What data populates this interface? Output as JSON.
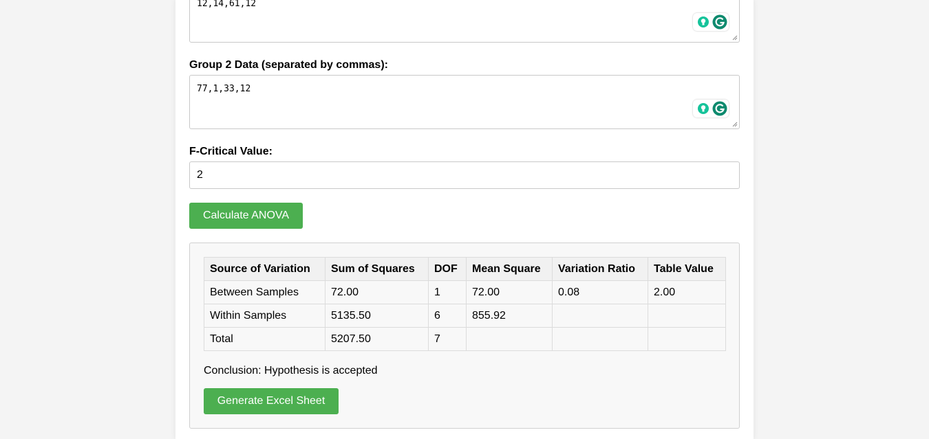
{
  "group1": {
    "value": "12,14,61,12"
  },
  "group2": {
    "label": "Group 2 Data (separated by commas):",
    "value": "77,1,33,12"
  },
  "f_critical": {
    "label": "F-Critical Value:",
    "value": "2"
  },
  "buttons": {
    "calculate": "Calculate ANOVA",
    "excel": "Generate Excel Sheet"
  },
  "table": {
    "headers": [
      "Source of Variation",
      "Sum of Squares",
      "DOF",
      "Mean Square",
      "Variation Ratio",
      "Table Value"
    ],
    "rows": [
      [
        "Between Samples",
        "72.00",
        "1",
        "72.00",
        "0.08",
        "2.00"
      ],
      [
        "Within Samples",
        "5135.50",
        "6",
        "855.92",
        "",
        ""
      ],
      [
        "Total",
        "5207.50",
        "7",
        "",
        "",
        ""
      ]
    ]
  },
  "conclusion": "Conclusion: Hypothesis is accepted",
  "colors": {
    "button": "#4caf50",
    "grammarly": "#15c39a",
    "grammarly_logo": "#0e8a6e"
  },
  "icons": {
    "assist": "lightbulb-icon",
    "grammarly": "grammarly-icon",
    "resize": "resize-grip-icon"
  }
}
